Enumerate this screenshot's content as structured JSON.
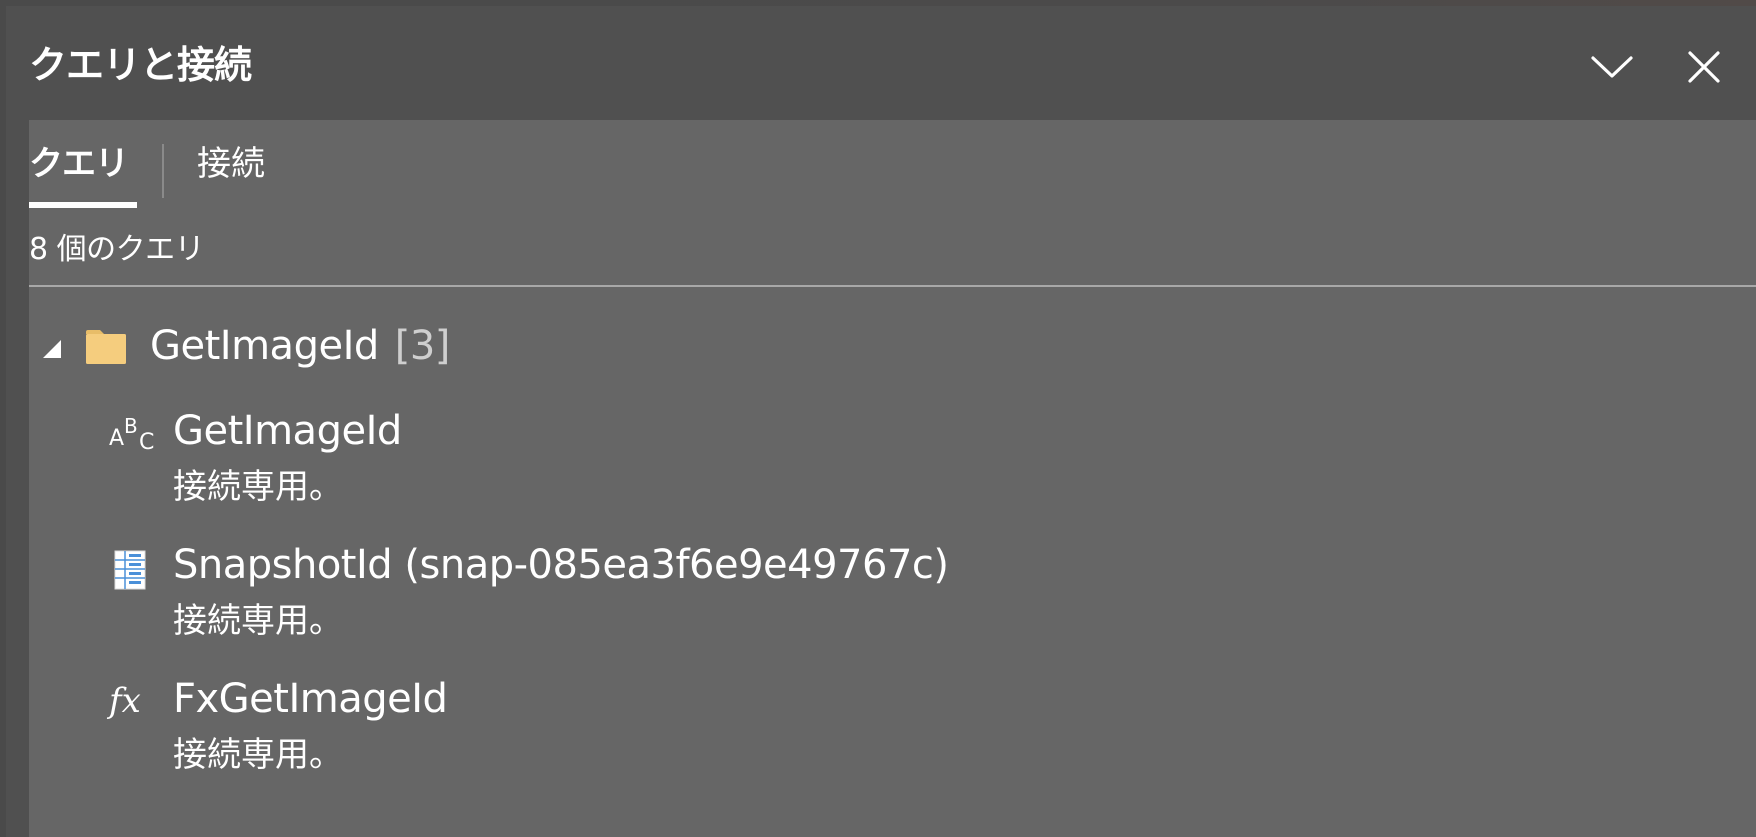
{
  "pane": {
    "title": "クエリと接続",
    "collapse_icon": "chevron-down-icon",
    "close_icon": "close-icon"
  },
  "tabs": {
    "queries_label": "クエリ",
    "connections_label": "接続",
    "active": "queries"
  },
  "query_count": "8 個のクエリ",
  "group": {
    "name": "GetImageId",
    "count": "[3]",
    "icon": "folder-icon",
    "expanded": true
  },
  "queries": [
    {
      "name": "GetImageId",
      "status": "接続専用。",
      "icon": "text-type-icon"
    },
    {
      "name": "SnapshotId (snap-085ea3f6e9e49767c)",
      "status": "接続専用。",
      "icon": "table-icon"
    },
    {
      "name": "FxGetImageId",
      "status": "接続専用。",
      "icon": "function-icon"
    }
  ],
  "colors": {
    "header_bg": "#505050",
    "content_bg": "#666666",
    "folder": "#f5cd7e",
    "table_icon_blue": "#4a90d9",
    "text": "#ffffff",
    "muted_text": "#cfcfcf"
  }
}
